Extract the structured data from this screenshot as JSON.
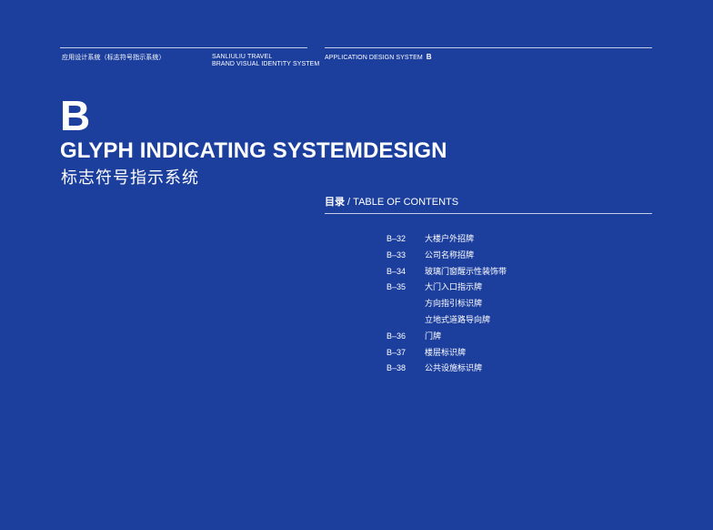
{
  "header": {
    "left": "应用设计系统（标志符号指示系统）",
    "mid_line1": "SANLIULIU TRAVEL",
    "mid_line2": "BRAND VISUAL IDENTITY SYSTEM",
    "right_label": "APPLICATION DESIGN SYSTEM",
    "right_letter": "B"
  },
  "section": {
    "letter": "B",
    "title_en": "GLYPH INDICATING SYSTEMDESIGN",
    "title_cn": "标志符号指示系统"
  },
  "toc": {
    "heading_cn": "目录",
    "heading_sep": " / ",
    "heading_en": "TABLE OF CONTENTS",
    "items": [
      {
        "code": "B–32",
        "title": "大楼户外招牌"
      },
      {
        "code": "B–33",
        "title": "公司名称招牌"
      },
      {
        "code": "B–34",
        "title": "玻璃门窗醒示性装饰带"
      },
      {
        "code": "B–35",
        "title": "大门入口指示牌"
      },
      {
        "code": "",
        "title": "方向指引标识牌"
      },
      {
        "code": "",
        "title": "立地式道路导向牌"
      },
      {
        "code": "B–36",
        "title": "门牌"
      },
      {
        "code": "B–37",
        "title": "楼层标识牌"
      },
      {
        "code": "B–38",
        "title": "公共设施标识牌"
      }
    ]
  },
  "colors": {
    "background": "#1c3f9e",
    "text": "#ffffff"
  }
}
